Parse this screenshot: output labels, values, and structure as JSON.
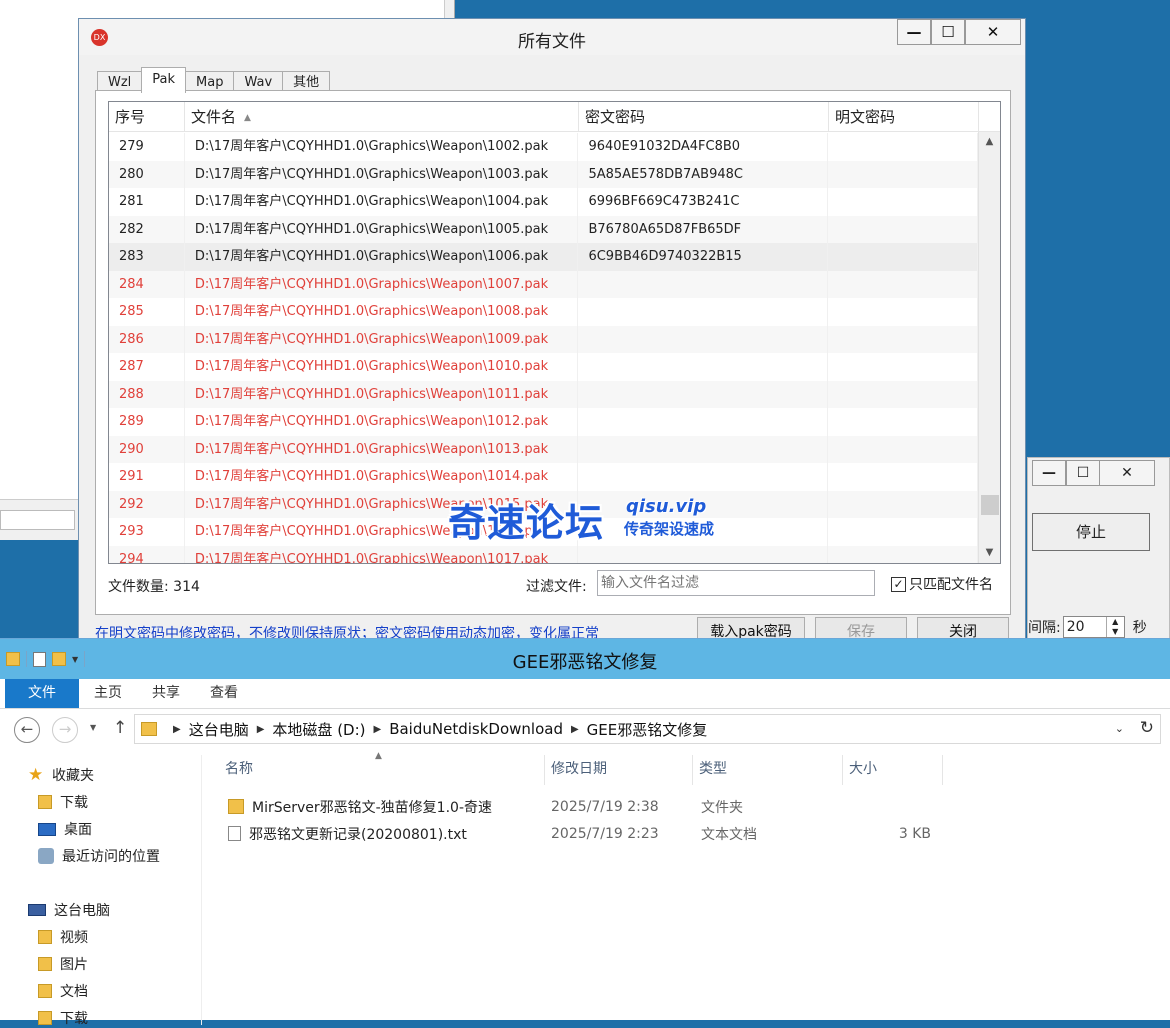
{
  "dialog": {
    "title": "所有文件",
    "app_icon_text": "DX",
    "tabs": [
      "Wzl",
      "Pak",
      "Map",
      "Wav",
      "其他"
    ],
    "active_tab": "Pak",
    "columns": [
      "序号",
      "文件名",
      "密文密码",
      "明文密码"
    ],
    "rows": [
      {
        "no": "279",
        "file": "D:\\17周年客户\\CQYHHD1.0\\Graphics\\Weapon\\1002.pak",
        "cipher": "9640E91032DA4FC8B0",
        "plain": ""
      },
      {
        "no": "280",
        "file": "D:\\17周年客户\\CQYHHD1.0\\Graphics\\Weapon\\1003.pak",
        "cipher": "5A85AE578DB7AB948C",
        "plain": ""
      },
      {
        "no": "281",
        "file": "D:\\17周年客户\\CQYHHD1.0\\Graphics\\Weapon\\1004.pak",
        "cipher": "6996BF669C473B241C",
        "plain": ""
      },
      {
        "no": "282",
        "file": "D:\\17周年客户\\CQYHHD1.0\\Graphics\\Weapon\\1005.pak",
        "cipher": "B76780A65D87FB65DF",
        "plain": ""
      },
      {
        "no": "283",
        "file": "D:\\17周年客户\\CQYHHD1.0\\Graphics\\Weapon\\1006.pak",
        "cipher": "6C9BB46D9740322B15",
        "plain": ""
      },
      {
        "no": "284",
        "file": "D:\\17周年客户\\CQYHHD1.0\\Graphics\\Weapon\\1007.pak",
        "cipher": "",
        "plain": ""
      },
      {
        "no": "285",
        "file": "D:\\17周年客户\\CQYHHD1.0\\Graphics\\Weapon\\1008.pak",
        "cipher": "",
        "plain": ""
      },
      {
        "no": "286",
        "file": "D:\\17周年客户\\CQYHHD1.0\\Graphics\\Weapon\\1009.pak",
        "cipher": "",
        "plain": ""
      },
      {
        "no": "287",
        "file": "D:\\17周年客户\\CQYHHD1.0\\Graphics\\Weapon\\1010.pak",
        "cipher": "",
        "plain": ""
      },
      {
        "no": "288",
        "file": "D:\\17周年客户\\CQYHHD1.0\\Graphics\\Weapon\\1011.pak",
        "cipher": "",
        "plain": ""
      },
      {
        "no": "289",
        "file": "D:\\17周年客户\\CQYHHD1.0\\Graphics\\Weapon\\1012.pak",
        "cipher": "",
        "plain": ""
      },
      {
        "no": "290",
        "file": "D:\\17周年客户\\CQYHHD1.0\\Graphics\\Weapon\\1013.pak",
        "cipher": "",
        "plain": ""
      },
      {
        "no": "291",
        "file": "D:\\17周年客户\\CQYHHD1.0\\Graphics\\Weapon\\1014.pak",
        "cipher": "",
        "plain": ""
      },
      {
        "no": "292",
        "file": "D:\\17周年客户\\CQYHHD1.0\\Graphics\\Weapon\\1015.pak",
        "cipher": "",
        "plain": ""
      },
      {
        "no": "293",
        "file": "D:\\17周年客户\\CQYHHD1.0\\Graphics\\Weapon\\1016.pak",
        "cipher": "",
        "plain": ""
      },
      {
        "no": "294",
        "file": "D:\\17周年客户\\CQYHHD1.0\\Graphics\\Weapon\\1017.pak",
        "cipher": "",
        "plain": ""
      }
    ],
    "count_label": "文件数量: 314",
    "filter_label": "过滤文件:",
    "filter_placeholder": "输入文件名过滤",
    "match_label": "只匹配文件名",
    "hint": "在明文密码中修改密码，不修改则保持原状；密文密码使用动态加密，变化属正常",
    "btn_load": "载入pak密码",
    "btn_save": "保存",
    "btn_close": "关闭",
    "colors": {
      "missing_row": "#e0403a",
      "hint": "#1540c9"
    }
  },
  "small_window": {
    "stop_label": "停止",
    "interval_label": "间隔:",
    "interval_value": "20",
    "interval_unit": "秒"
  },
  "watermark": {
    "main": "奇速论坛",
    "domain": "qisu.vip",
    "slogan": "传奇架设速成"
  },
  "explorer": {
    "title": "GEE邪恶铭文修复",
    "ribbon_tabs": [
      "文件",
      "主页",
      "共享",
      "查看"
    ],
    "address": [
      "这台电脑",
      "本地磁盘 (D:)",
      "BaiduNetdiskDownload",
      "GEE邪恶铭文修复"
    ],
    "nav_pane": {
      "favorites": "收藏夹",
      "fav_items": [
        "下载",
        "桌面",
        "最近访问的位置"
      ],
      "this_pc": "这台电脑",
      "pc_items": [
        "视频",
        "图片",
        "文档",
        "下载"
      ]
    },
    "columns": [
      "名称",
      "修改日期",
      "类型",
      "大小"
    ],
    "files": [
      {
        "name": "MirServer邪恶铭文-独苗修复1.0-奇速",
        "date": "2025/7/19 2:38",
        "type": "文件夹",
        "size": "",
        "icon": "folder-icon"
      },
      {
        "name": "邪恶铭文更新记录(20200801).txt",
        "date": "2025/7/19 2:23",
        "type": "文本文档",
        "size": "3 KB",
        "icon": "text-file-icon"
      }
    ]
  }
}
